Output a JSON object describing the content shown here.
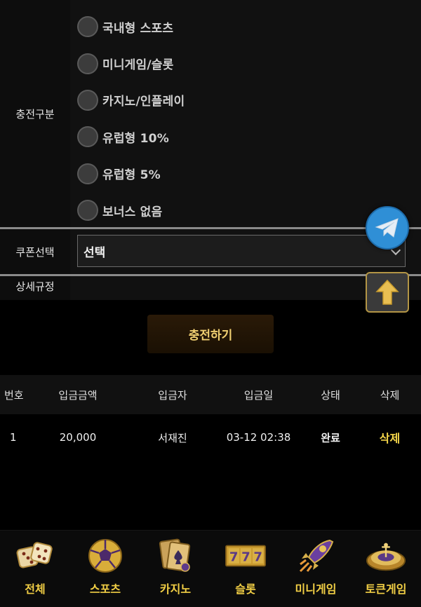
{
  "deposit_type": {
    "label": "충전구분",
    "options": [
      {
        "label": "국내형 스포츠"
      },
      {
        "label": "미니게임/슬롯"
      },
      {
        "label": "카지노/인플레이"
      },
      {
        "label": "유럽형 10%"
      },
      {
        "label": "유럽형 5%"
      },
      {
        "label": "보너스 없음"
      }
    ]
  },
  "coupon": {
    "label": "쿠폰선택",
    "selected": "선택"
  },
  "rules": {
    "label": "상세규정"
  },
  "charge_button": {
    "label": "충전하기"
  },
  "table": {
    "headers": [
      "번호",
      "입금금액",
      "입금자",
      "입금일",
      "상태",
      "삭제"
    ],
    "rows": [
      {
        "no": "1",
        "amount": "20,000",
        "depositor": "서재진",
        "date": "03-12 02:38",
        "status": "완료",
        "delete": "삭제"
      }
    ]
  },
  "bottom_nav": [
    {
      "label": "전체",
      "icon": "dice-icon"
    },
    {
      "label": "스포츠",
      "icon": "soccer-ball-icon"
    },
    {
      "label": "카지노",
      "icon": "playing-cards-icon"
    },
    {
      "label": "슬롯",
      "icon": "slot-777-icon"
    },
    {
      "label": "미니게임",
      "icon": "rocket-icon"
    },
    {
      "label": "토큰게임",
      "icon": "roulette-icon"
    }
  ],
  "colors": {
    "accent_gold": "#f2cf45",
    "telegram_blue": "#2f8fd6",
    "background": "#000000"
  }
}
